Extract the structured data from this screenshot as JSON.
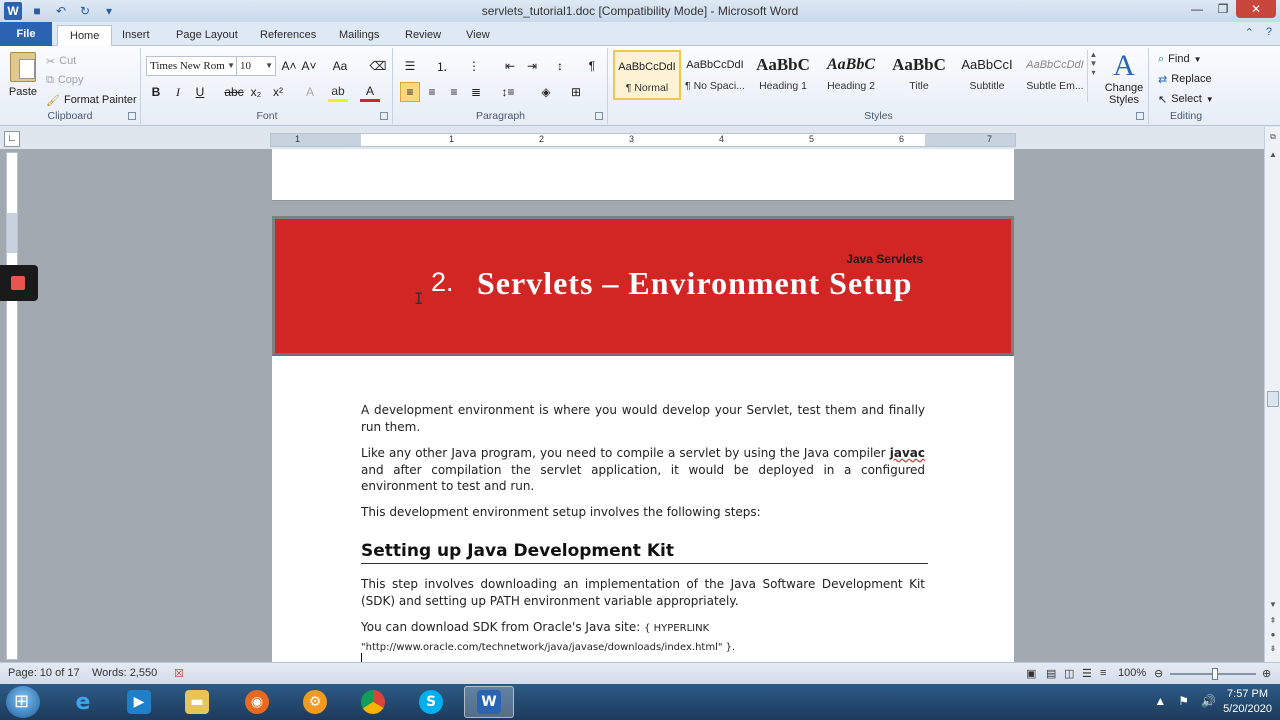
{
  "window": {
    "title": "servlets_tutorial1.doc [Compatibility Mode]  -  Microsoft Word",
    "qat": [
      "W",
      "💾",
      "↶",
      "↻",
      "▾"
    ]
  },
  "tabs": [
    "File",
    "Home",
    "Insert",
    "Page Layout",
    "References",
    "Mailings",
    "Review",
    "View"
  ],
  "ribbon": {
    "clipboard": {
      "label": "Clipboard",
      "paste": "Paste",
      "cut": "Cut",
      "copy": "Copy",
      "format_painter": "Format Painter"
    },
    "font": {
      "label": "Font",
      "name": "Times New Rom",
      "size": "10"
    },
    "paragraph": {
      "label": "Paragraph"
    },
    "styles": {
      "label": "Styles",
      "items": [
        {
          "sample": "AaBbCcDdI",
          "name": "¶ Normal"
        },
        {
          "sample": "AaBbCcDdI",
          "name": "¶ No Spaci..."
        },
        {
          "sample": "AaBbC",
          "name": "Heading 1"
        },
        {
          "sample": "AaBbC",
          "name": "Heading 2"
        },
        {
          "sample": "AaBbC",
          "name": "Title"
        },
        {
          "sample": "AaBbCcI",
          "name": "Subtitle"
        },
        {
          "sample": "AaBbCcDdI",
          "name": "Subtle Em..."
        }
      ],
      "change_styles": "Change Styles"
    },
    "editing": {
      "label": "Editing",
      "find": "Find",
      "replace": "Replace",
      "select": "Select"
    }
  },
  "ruler": [
    "1",
    "1",
    "2",
    "3",
    "4",
    "5",
    "6",
    "7"
  ],
  "document": {
    "running_header": "Java Servlets",
    "chapter_number": "2.",
    "chapter_title": "Servlets – Environment Setup",
    "p1": "A development environment is where you would develop your Servlet, test them and finally run them.",
    "p2_start": "Like any other Java program, you need to compile a servlet by using the Java compiler ",
    "p2_code": "javac",
    "p2_end": " and after compilation the servlet application, it would be deployed in a configured environment to test and run.",
    "p3": "This development environment setup involves the following steps:",
    "heading": "Setting up Java Development Kit",
    "p4": "This step involves downloading an implementation of the Java Software Development Kit (SDK) and setting up PATH environment variable appropriately.",
    "p5_start": "You can download SDK from Oracle's Java site: ",
    "p5_field": "{ HYPERLINK \"http://www.oracle.com/technetwork/java/javase/downloads/index.html\"  }."
  },
  "status": {
    "page": "Page: 10 of 17",
    "words": "Words: 2,550",
    "zoom": "100%"
  },
  "taskbar": {
    "time": "7:57 PM",
    "date": "5/20/2020"
  }
}
